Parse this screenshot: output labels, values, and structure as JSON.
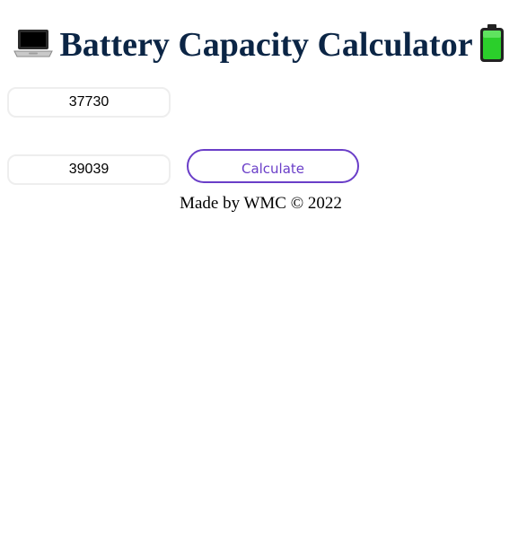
{
  "header": {
    "title": "Battery Capacity Calculator",
    "left_icon": "laptop-icon",
    "right_icon": "battery-icon"
  },
  "form": {
    "design_capacity_value": "37730",
    "full_charge_capacity_value": "39039",
    "calculate_label": "Calculate"
  },
  "footer": {
    "text": "Made by WMC © 2022"
  },
  "colors": {
    "title": "#0b2545",
    "button_accent": "#6a3ec8",
    "input_border": "#eeeeee"
  }
}
